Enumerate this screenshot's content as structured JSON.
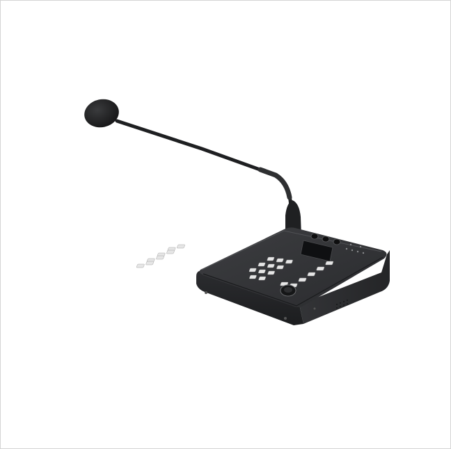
{
  "image": {
    "subject": "paging-microphone-console",
    "icons": [
      "gooseneck-microphone-icon",
      "console-keypad-icon",
      "lcd-display-icon",
      "volume-knob-icon",
      "ptt-button-icon"
    ],
    "colors": {
      "background": "#ffffff",
      "frame_border": "#d4d4d4",
      "body_dark": "#2a2b2d",
      "body_mid": "#3a3b3e",
      "key_light": "#e9e9e9",
      "screen": "#111214"
    }
  }
}
